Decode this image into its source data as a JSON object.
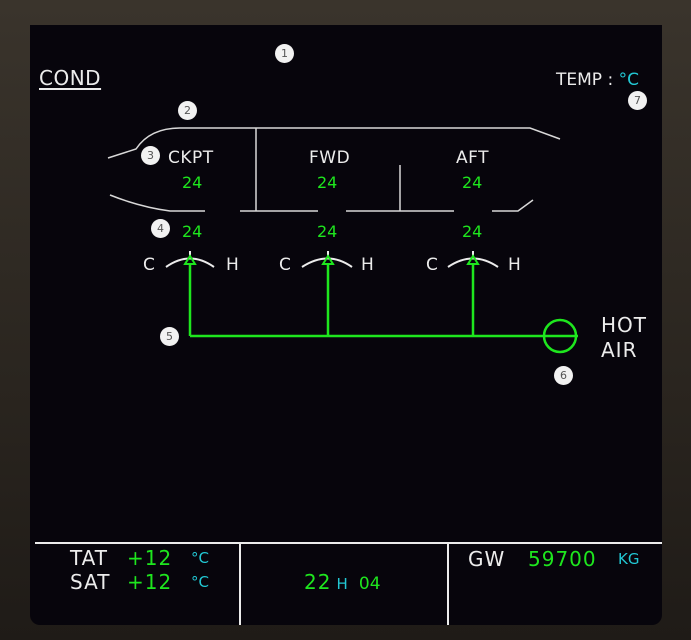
{
  "page": {
    "title": "COND",
    "temp_label": "TEMP :",
    "temp_unit": "°C"
  },
  "colors": {
    "active": "#1ee61e",
    "label": "#ececec",
    "unit": "#22c8d4",
    "background": "#07050c"
  },
  "zones": [
    {
      "name": "CKPT",
      "cabin_temp": "24",
      "duct_temp": "24"
    },
    {
      "name": "FWD",
      "cabin_temp": "24",
      "duct_temp": "24"
    },
    {
      "name": "AFT",
      "cabin_temp": "24",
      "duct_temp": "24"
    }
  ],
  "valve_scale": {
    "cold_label": "C",
    "hot_label": "H"
  },
  "hot_air": {
    "label_line1": "HOT",
    "label_line2": "AIR",
    "valve_state": "open"
  },
  "callouts": [
    "1",
    "2",
    "3",
    "4",
    "5",
    "6",
    "7"
  ],
  "footer": {
    "tat_label": "TAT",
    "tat_value": "+12",
    "tat_unit": "°C",
    "sat_label": "SAT",
    "sat_value": "+12",
    "sat_unit": "°C",
    "time_hours": "22",
    "time_sep": "H",
    "time_minutes": "04",
    "gw_label": "GW",
    "gw_value": "59700",
    "gw_unit": "KG"
  }
}
